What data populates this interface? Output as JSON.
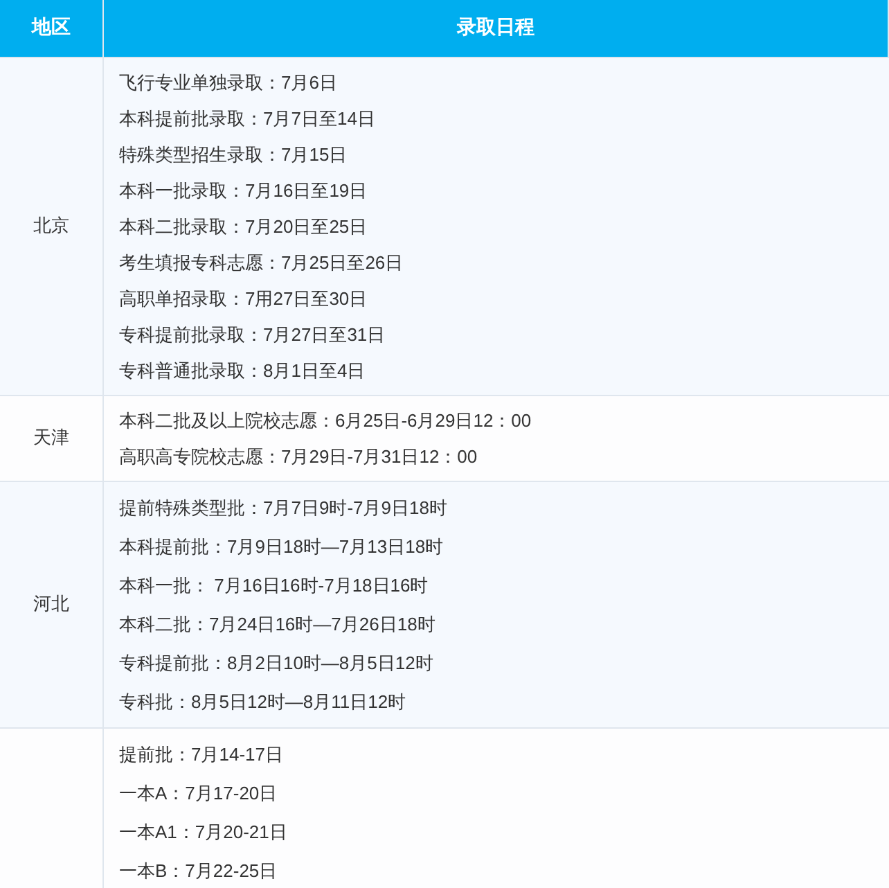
{
  "table": {
    "columns": [
      "地区",
      "录取日程"
    ],
    "rows": [
      {
        "region": "北京",
        "lines": [
          "飞行专业单独录取：7月6日",
          "本科提前批录取：7月7日至14日",
          "特殊类型招生录取：7月15日",
          "本科一批录取：7月16日至19日",
          "本科二批录取：7月20日至25日",
          "考生填报专科志愿：7月25日至26日",
          "高职单招录取：7用27日至30日",
          "专科提前批录取：7月27日至31日",
          "专科普通批录取：8月1日至4日"
        ]
      },
      {
        "region": "天津",
        "lines": [
          "本科二批及以上院校志愿：6月25日-6月29日12：00",
          "高职高专院校志愿：7月29日-7月31日12：00"
        ]
      },
      {
        "region": "河北",
        "lines": [
          "提前特殊类型批：7月7日9时-7月9日18时",
          "本科提前批：7月9日18时—7月13日18时",
          "本科一批： 7月16日16时-7月18日16时",
          "本科二批：7月24日16时—7月26日18时",
          "专科提前批：8月2日10时—8月5日12时",
          "专科批：8月5日12时—8月11日12时"
        ]
      },
      {
        "lines": [
          "提前批：7月14-17日",
          "一本A：7月17-20日",
          "一本A1：7月20-21日",
          "一本B：7月22-25日"
        ]
      }
    ]
  }
}
